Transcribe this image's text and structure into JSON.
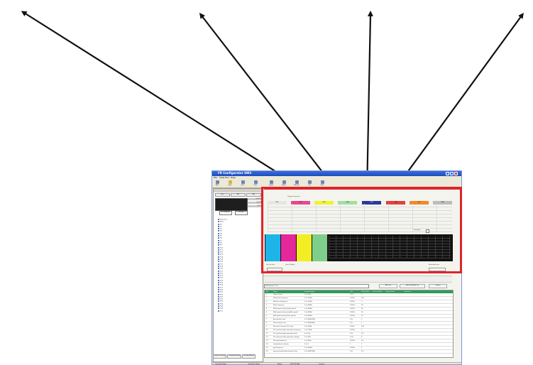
{
  "window": {
    "title": "FR Configurator SW3",
    "menu": [
      "File",
      "View",
      "Tool",
      "Help"
    ]
  },
  "toolbar": {
    "buttons": [
      "New",
      "Open",
      "Save",
      "Print",
      "Graph",
      "Batch",
      "Monitor",
      "List",
      "Help"
    ]
  },
  "left_pane": {
    "tabs": [
      "Ext.",
      "SET",
      "NET"
    ],
    "lcd_readout": [
      "0.00 Hz",
      "0.00 A",
      "0.0 V"
    ],
    "buttons": [
      "STOP/RESET",
      "EXT/PU"
    ],
    "tree": [
      "Parameter",
      "Basic",
      "P.0",
      "P.1",
      "P.2",
      "P.3",
      "P.4",
      "P.5",
      "P.6",
      "P.7",
      "P.8",
      "P.9",
      "P.10",
      "P.11",
      "P.12",
      "P.13",
      "P.14",
      "P.15",
      "P.16",
      "P.17",
      "P.18",
      "P.19",
      "P.20",
      "P.21",
      "P.22",
      "P.23",
      "P.24",
      "P.25",
      "P.26",
      "P.27",
      "P.28",
      "P.29",
      "P.30",
      "P.31",
      "P.32",
      "P.33",
      "P.34",
      "P.35",
      "P.36",
      "P.37"
    ],
    "bottom_tabs": [
      "System Setting",
      "Troubleshooting",
      "Setting Wizard"
    ]
  },
  "graph": {
    "labels": [
      "Trigger Frequency",
      "Sampling"
    ],
    "channels": [
      {
        "label": "CH1",
        "color": "#e6e6e6"
      },
      {
        "label": "CH2",
        "color": "#e8478f"
      },
      {
        "label": "CH3",
        "color": "#f2f22a"
      },
      {
        "label": "CH4",
        "color": "#9ee09e"
      },
      {
        "label": "CH5",
        "color": "#2a3a9a"
      },
      {
        "label": "CH6",
        "color": "#e3413d"
      },
      {
        "label": "CH7",
        "color": "#f08a2a"
      },
      {
        "label": "CH8",
        "color": "#bcbcbc"
      }
    ],
    "scope_colors": [
      "#1db4e8",
      "#e6279b",
      "#f2ee23",
      "#7fcf8a"
    ],
    "controls": [
      "Vertical axis",
      "Scale Display",
      "Horizontal axis"
    ]
  },
  "parameter_list": {
    "filter": "All Parameter List",
    "buttons": [
      "ALL List",
      "Edit Individual List",
      "Search"
    ],
    "columns": [
      "No.",
      "Name",
      "Setting Range",
      "Unit",
      "Initial Value",
      "Current Value",
      "Setting Value",
      "Comment"
    ],
    "rows": [
      {
        "no": "0",
        "name": "Torque boost",
        "range": "0 to 30%",
        "unit": "0.1%",
        "init": "6"
      },
      {
        "no": "1",
        "name": "Maximum frequency",
        "range": "0 to 120Hz",
        "unit": "0.01Hz",
        "init": "120"
      },
      {
        "no": "2",
        "name": "Minimum frequency",
        "range": "0 to 120Hz",
        "unit": "0.01Hz",
        "init": "0"
      },
      {
        "no": "3",
        "name": "Base frequency",
        "range": "0 to 400Hz",
        "unit": "0.01Hz",
        "init": "60"
      },
      {
        "no": "4",
        "name": "Multi-speed setting (high speed)",
        "range": "0 to 400Hz",
        "unit": "0.01Hz",
        "init": "60"
      },
      {
        "no": "5",
        "name": "Multi-speed setting (middle speed)",
        "range": "0 to 400Hz",
        "unit": "0.01Hz",
        "init": "30"
      },
      {
        "no": "6",
        "name": "Multi-speed setting (low speed)",
        "range": "0 to 400Hz",
        "unit": "0.01Hz",
        "init": "10"
      },
      {
        "no": "7",
        "name": "Acceleration time",
        "range": "0 to 3600/360s",
        "unit": "0.1s",
        "init": "5"
      },
      {
        "no": "8",
        "name": "Deceleration time",
        "range": "0 to 3600/360s",
        "unit": "0.1s",
        "init": "5"
      },
      {
        "no": "9",
        "name": "Electronic thermal O/L relay",
        "range": "0 to 500A",
        "unit": "0.01A",
        "init": "0.00"
      },
      {
        "no": "10",
        "name": "DC injection brake operation frequency",
        "range": "0 to 120Hz",
        "unit": "0.01Hz",
        "init": "3"
      },
      {
        "no": "11",
        "name": "DC injection brake operation time",
        "range": "0 to 10s",
        "unit": "0.1s",
        "init": "0.5"
      },
      {
        "no": "12",
        "name": "DC injection brake operation voltage",
        "range": "0 to 30%",
        "unit": "0.1%",
        "init": "4"
      },
      {
        "no": "13",
        "name": "Starting frequency",
        "range": "0 to 60Hz",
        "unit": "0.01Hz",
        "init": "0.5"
      },
      {
        "no": "14",
        "name": "Load pattern selection",
        "range": "0 to 3",
        "unit": "1",
        "init": "0"
      },
      {
        "no": "15",
        "name": "Jog frequency",
        "range": "0 to 400Hz",
        "unit": "0.01Hz",
        "init": "5"
      },
      {
        "no": "16",
        "name": "Jog acceleration/deceleration time",
        "range": "0 to 3600/360s",
        "unit": "0.1s",
        "init": "0.5"
      }
    ]
  },
  "status_bar": [
    "Operation Mode",
    "Operation Status",
    "Model",
    "FR-E700 (NA)",
    "Connect"
  ]
}
